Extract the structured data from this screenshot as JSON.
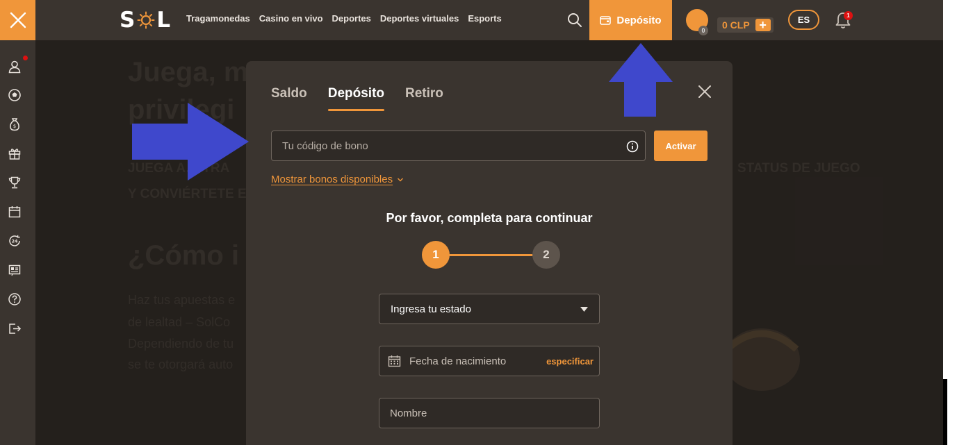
{
  "header": {
    "logo": {
      "left": "S",
      "right": "L"
    },
    "nav": [
      "Tragamonedas",
      "Casino en vivo",
      "Deportes",
      "Deportes virtuales",
      "Esports"
    ],
    "deposit_label": "Depósito",
    "avatar_badge": "0",
    "balance": "0 CLP",
    "balance_plus": "+",
    "language": "ES",
    "notification_count": "1"
  },
  "background_page": {
    "heading1": "Juega, m",
    "heading2": "privilegi",
    "subtitle1": "JUEGA A… TRA",
    "subtitle1_right": "STATUS DE JUEGO",
    "subtitle2": "Y CONVIÉRTETE E",
    "section_title": "¿Cómo i",
    "para1": "Haz tus apuestas e",
    "para2": "de lealtad – SolCo",
    "para3": "Dependiendo de tu",
    "para4": "se te otorgará auto"
  },
  "modal": {
    "tabs": [
      {
        "label": "Saldo",
        "active": false
      },
      {
        "label": "Depósito",
        "active": true
      },
      {
        "label": "Retiro",
        "active": false
      }
    ],
    "bonus_placeholder": "Tu código de bono",
    "activate_label": "Activar",
    "show_bonuses_label": "Mostrar bonos disponibles",
    "form_title": "Por favor, completa para continuar",
    "steps": [
      "1",
      "2"
    ],
    "state_select_value": "Ingresa tu estado",
    "birthdate_label": "Fecha de nacimiento",
    "birthdate_action": "especificar",
    "name_placeholder": "Nombre"
  },
  "colors": {
    "accent": "#f0963a",
    "header_bg": "#3a342f",
    "page_bg": "#2b2622",
    "arrow": "#3f48cc",
    "badge": "#dd1111"
  }
}
